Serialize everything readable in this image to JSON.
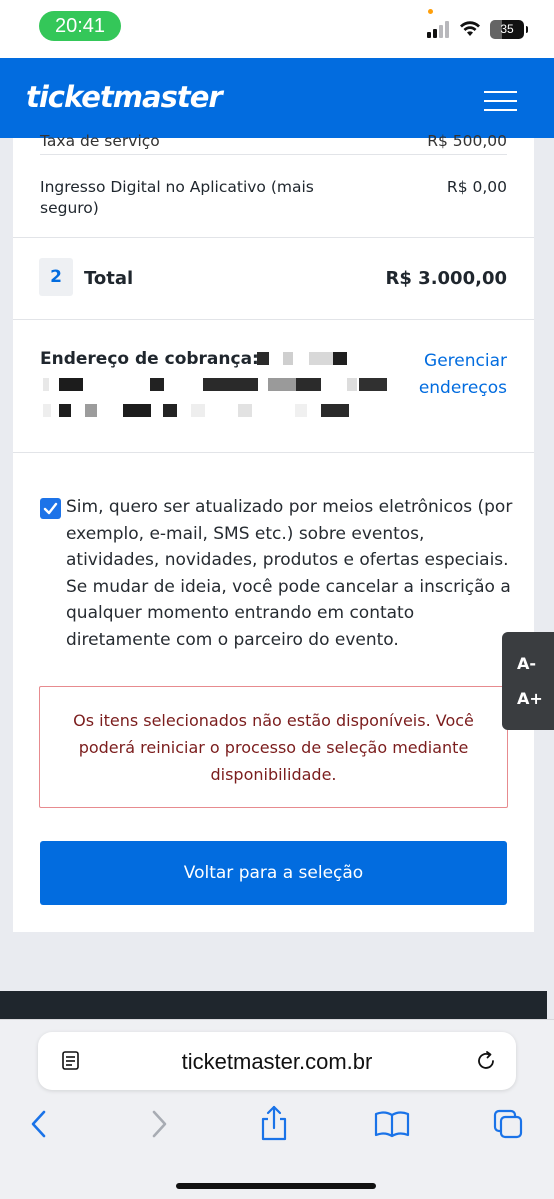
{
  "status_bar": {
    "time": "20:41",
    "battery": "35",
    "battery_level": 0.35
  },
  "header": {
    "logo": "ticketmaster"
  },
  "order": {
    "partial_fee_label": "Taxa de serviço",
    "partial_fee_value": "R$ 500,00",
    "digital_label": "Ingresso Digital no Aplicativo (mais seguro)",
    "digital_value": "R$ 0,00",
    "quantity": "2",
    "total_label": "Total",
    "total_value": "R$ 3.000,00"
  },
  "billing": {
    "label": "Endereço de cobrança:",
    "manage_link": "Gerenciar endereços"
  },
  "consent": {
    "checked": true,
    "text": "Sim, quero ser atualizado por meios eletrônicos (por exemplo, e-mail, SMS etc.) sobre eventos, atividades, novidades, produtos e ofertas especiais. Se mudar de ideia, você pode cancelar a inscrição a qualquer momento entrando em contato diretamente com o parceiro do evento."
  },
  "error": {
    "message": "Os itens selecionados não estão disponíveis. Você poderá reiniciar o processo de seleção mediante disponibilidade."
  },
  "actions": {
    "back_label": "Voltar para a seleção"
  },
  "font_size": {
    "decrease": "A-",
    "increase": "A+"
  },
  "browser": {
    "url": "ticketmaster.com.br"
  },
  "colors": {
    "brand": "#026cdf",
    "error_text": "#7b1d1d",
    "error_border": "#e78b8f"
  }
}
